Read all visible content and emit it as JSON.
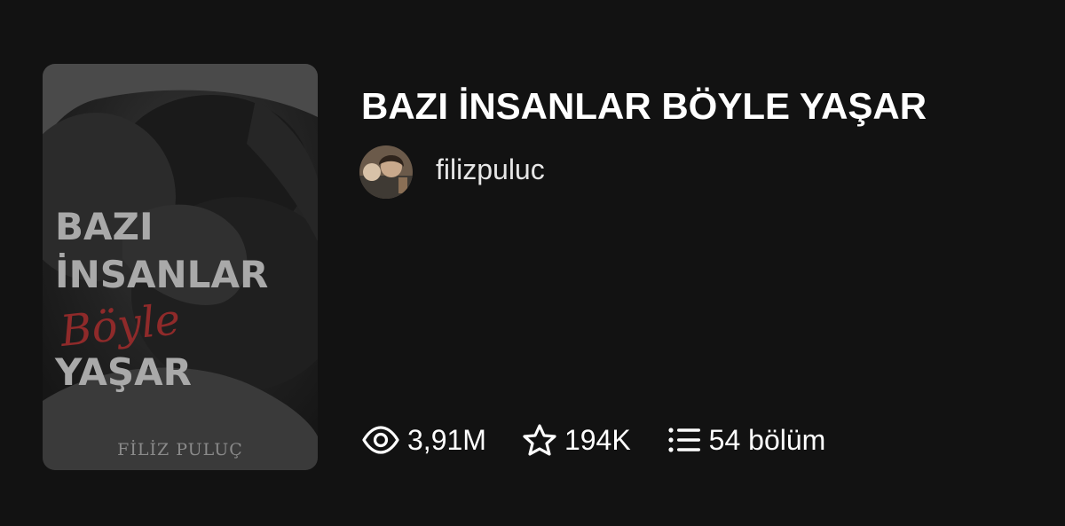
{
  "story": {
    "title": "BAZI İNSANLAR BÖYLE YAŞAR",
    "author": "filizpuluc"
  },
  "cover": {
    "line1": "BAZI",
    "line2": "İNSANLAR",
    "script": "Böyle",
    "line4": "YAŞAR",
    "author": "FİLİZ PULUÇ"
  },
  "stats": {
    "reads": "3,91M",
    "votes": "194K",
    "parts": "54 bölüm"
  },
  "icons": {
    "reads": "eye-icon",
    "votes": "star-icon",
    "parts": "list-icon"
  },
  "colors": {
    "background": "#121212",
    "title": "#ffffff",
    "cover_script": "#8f2a2a"
  }
}
